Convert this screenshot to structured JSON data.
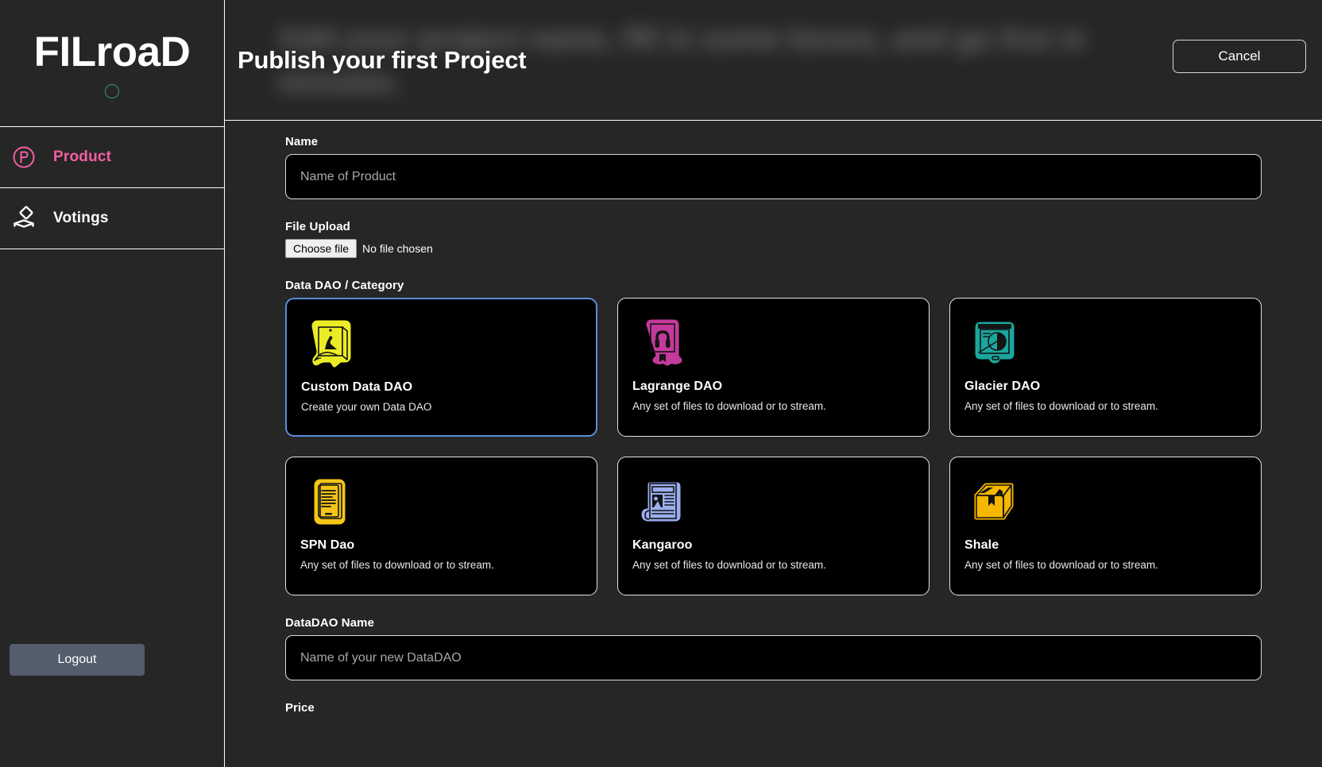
{
  "sidebar": {
    "brand": {
      "name": "FILroaD",
      "status_icon": "status-circle-icon"
    },
    "items": [
      {
        "id": "product",
        "label": "Product",
        "icon": "product-circle-p-icon",
        "color": "#f25fa3",
        "active": true
      },
      {
        "id": "votings",
        "label": "Votings",
        "icon": "ballot-box-icon",
        "color": "#ffffff",
        "active": false
      }
    ],
    "logout_label": "Logout"
  },
  "header": {
    "title": "Publish your first Project",
    "ghost_text": "Add your project name, fill in some boxes, and go live in minutes.",
    "cancel_label": "Cancel"
  },
  "form": {
    "name_field": {
      "label": "Name",
      "placeholder": "Name of Product",
      "value": ""
    },
    "file_upload": {
      "label": "File Upload",
      "button_label": "Choose file",
      "status": "No file chosen"
    },
    "category": {
      "label": "Data DAO / Category",
      "cards": [
        {
          "id": "custom-data-dao",
          "title": "Custom Data DAO",
          "description": "Create your own Data DAO",
          "icon": "custom-data-dao-icon",
          "color": "#ecec26",
          "selected": true
        },
        {
          "id": "lagrange-dao",
          "title": "Lagrange DAO",
          "description": "Any set of files to download or to stream.",
          "icon": "audiobook-icon",
          "color": "#c6399c",
          "selected": false
        },
        {
          "id": "glacier-dao",
          "title": "Glacier DAO",
          "description": "Any set of files to download or to stream.",
          "icon": "presentation-chart-icon",
          "color": "#1ba69c",
          "selected": false
        },
        {
          "id": "spn-dao",
          "title": "SPN Dao",
          "description": "Any set of files to download or to stream.",
          "icon": "ereader-icon",
          "color": "#f5c518",
          "selected": false
        },
        {
          "id": "kangaroo",
          "title": "Kangaroo",
          "description": "Any set of files to download or to stream.",
          "icon": "newspaper-icon",
          "color": "#9aaef0",
          "selected": false
        },
        {
          "id": "shale",
          "title": "Shale",
          "description": "Any set of files to download or to stream.",
          "icon": "package-box-icon",
          "color": "#f5b700",
          "selected": false
        }
      ]
    },
    "datadao_name_field": {
      "label": "DataDAO Name",
      "placeholder": "Name of your new DataDAO",
      "value": ""
    },
    "price_field": {
      "label": "Price"
    }
  },
  "colors": {
    "background": "#262626",
    "panel_black": "#000000",
    "border": "#e6e6e6",
    "accent_pink": "#f25fa3",
    "selected_blue": "#5b8dd9",
    "logout_gray": "#545d6b",
    "status_green": "#3f9a62"
  }
}
